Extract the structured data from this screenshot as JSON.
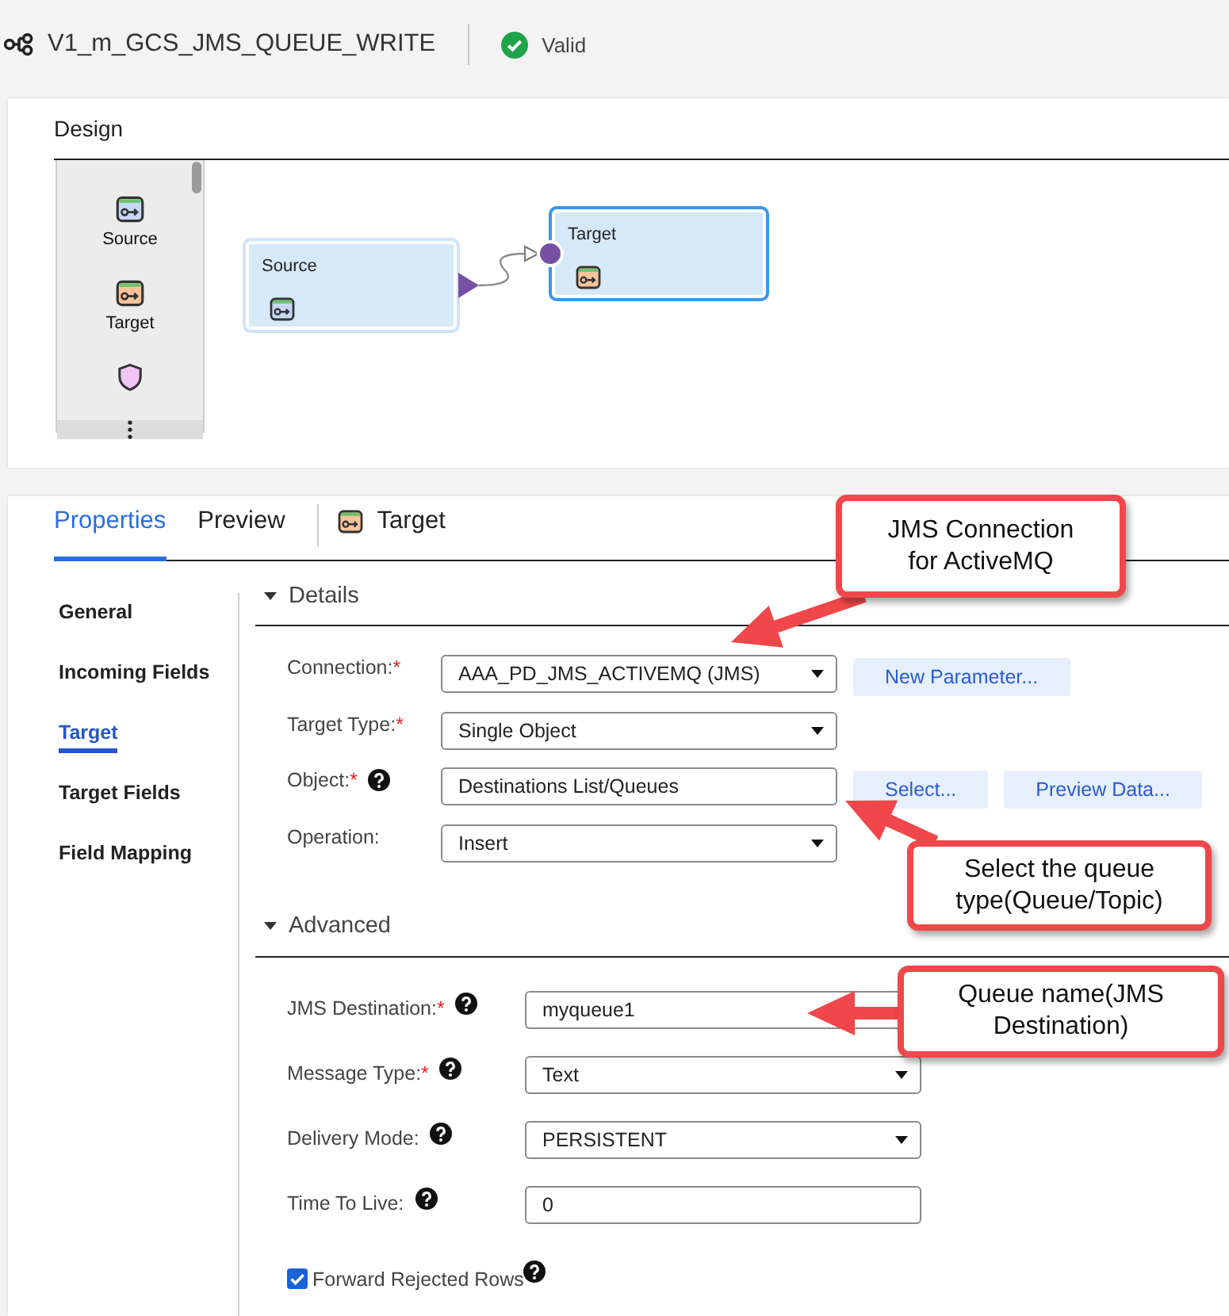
{
  "header": {
    "title": "V1_m_GCS_JMS_QUEUE_WRITE",
    "status": {
      "kind": "valid",
      "label": "Valid"
    }
  },
  "design": {
    "title": "Design",
    "palette": [
      {
        "kind": "source",
        "label": "Source"
      },
      {
        "kind": "target",
        "label": "Target"
      },
      {
        "kind": "shield"
      }
    ],
    "nodes": [
      {
        "kind": "source",
        "label": "Source",
        "selected": false
      },
      {
        "kind": "target",
        "label": "Target",
        "selected": true
      }
    ]
  },
  "properties": {
    "tabs": [
      {
        "label": "Properties",
        "selected": true
      },
      {
        "label": "Preview",
        "selected": false
      }
    ],
    "object": {
      "kind": "target",
      "label": "Target"
    },
    "nav": [
      {
        "label": "General",
        "selected": false
      },
      {
        "label": "Incoming Fields",
        "selected": false
      },
      {
        "label": "Target",
        "selected": true
      },
      {
        "label": "Target Fields",
        "selected": false
      },
      {
        "label": "Field Mapping",
        "selected": false
      }
    ],
    "sections": [
      {
        "title": "Details",
        "expanded": true,
        "fields": [
          {
            "label": "Connection:",
            "required_mark": "*",
            "help": false,
            "kind": "select",
            "value": "AAA_PD_JMS_ACTIVEMQ (JMS)",
            "buttons": [
              "New Parameter..."
            ]
          },
          {
            "label": "Target Type:",
            "required_mark": "*",
            "help": false,
            "kind": "select",
            "value": "Single Object"
          },
          {
            "label": "Object:",
            "required_mark": "*",
            "help": true,
            "kind": "input",
            "value": "Destinations List/Queues",
            "buttons": [
              "Select...",
              "Preview Data..."
            ]
          },
          {
            "label": "Operation:",
            "help": false,
            "kind": "select",
            "value": "Insert"
          }
        ]
      },
      {
        "title": "Advanced",
        "expanded": true,
        "fields": [
          {
            "label": "JMS Destination:",
            "required_mark": "*",
            "help": true,
            "kind": "input",
            "value": "myqueue1"
          },
          {
            "label": "Message Type:",
            "required_mark": "*",
            "help": true,
            "kind": "select",
            "value": "Text"
          },
          {
            "label": "Delivery Mode:",
            "help": true,
            "kind": "select",
            "value": "PERSISTENT"
          },
          {
            "label": "Time To Live:",
            "help": true,
            "kind": "input",
            "value": "0"
          }
        ],
        "checkbox": {
          "label": "Forward Rejected Rows",
          "checked": true,
          "help": true
        }
      }
    ]
  },
  "annotations": [
    {
      "text": "JMS Connection\nfor ActiveMQ"
    },
    {
      "text": "Select the queue\ntype(Queue/Topic)"
    },
    {
      "text": "Queue name(JMS\nDestination)"
    }
  ]
}
